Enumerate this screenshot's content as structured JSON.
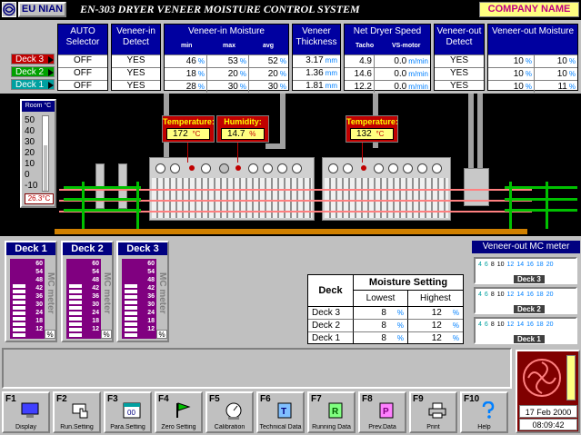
{
  "header": {
    "brand": "EU NIAN",
    "title": "EN-303 DRYER VENEER MOISTURE CONTROL SYSTEM",
    "company": "COMPANY NAME"
  },
  "columns": {
    "auto_selector": "AUTO Selector",
    "veneer_in_detect": "Veneer-in Detect",
    "veneer_in_moisture": "Veneer-in Moisture",
    "moisture_sub": [
      "min",
      "max",
      "avg"
    ],
    "veneer_thickness": "Veneer Thickness",
    "net_dryer_speed": "Net Dryer Speed",
    "speed_sub": [
      "Tacho",
      "VS-motor"
    ],
    "veneer_out_detect": "Veneer-out Detect",
    "veneer_out_moisture": "Veneer-out Moisture"
  },
  "units": {
    "pct": "%",
    "mm": "mm",
    "speed": "m/min",
    "temp": "°C"
  },
  "rows": [
    {
      "deck": "Deck 3",
      "color": "#c00000",
      "auto": "OFF",
      "in_detect": "YES",
      "min": "46",
      "max": "53",
      "avg": "52",
      "thick": "3.17",
      "tacho": "4.9",
      "vs": "0.0",
      "out_detect": "YES",
      "out_a": "10",
      "out_b": "10"
    },
    {
      "deck": "Deck 2",
      "color": "#00a000",
      "auto": "OFF",
      "in_detect": "YES",
      "min": "18",
      "max": "20",
      "avg": "20",
      "thick": "1.36",
      "tacho": "14.6",
      "vs": "0.0",
      "out_detect": "YES",
      "out_a": "10",
      "out_b": "10"
    },
    {
      "deck": "Deck 1",
      "color": "#00a0a0",
      "auto": "OFF",
      "in_detect": "YES",
      "min": "28",
      "max": "30",
      "avg": "30",
      "thick": "1.81",
      "tacho": "12.2",
      "vs": "0.0",
      "out_detect": "YES",
      "out_a": "10",
      "out_b": "11"
    }
  ],
  "room": {
    "label": "Room °C",
    "ticks": [
      "50",
      "40",
      "30",
      "20",
      "10",
      "0",
      "-10"
    ],
    "value": "26.3°C",
    "level": 26.3
  },
  "readouts": {
    "temp1_label": "Temperature:",
    "temp1_value": "172",
    "humidity_label": "Humidity:",
    "humidity_value": "14.7",
    "temp2_label": "Temperature:",
    "temp2_value": "132"
  },
  "meters": [
    {
      "title": "Deck 1",
      "side": "MC meter",
      "level": 12
    },
    {
      "title": "Deck 2",
      "side": "MC meter",
      "level": 12
    },
    {
      "title": "Deck 3",
      "side": "MC meter",
      "level": 12
    }
  ],
  "meter_ticks": [
    "60",
    "54",
    "48",
    "42",
    "36",
    "30",
    "24",
    "18",
    "12"
  ],
  "meter_pct": "%",
  "moisture_setting": {
    "deck_header": "Deck",
    "title": "Moisture Setting",
    "lowest": "Lowest",
    "highest": "Highest",
    "rows": [
      {
        "deck": "Deck 3",
        "low": "8",
        "high": "12"
      },
      {
        "deck": "Deck 2",
        "low": "8",
        "high": "12"
      },
      {
        "deck": "Deck 1",
        "low": "8",
        "high": "12"
      }
    ]
  },
  "veneer_out_mc": {
    "title": "Veneer-out MC meter",
    "scale": [
      "4",
      "6",
      "8",
      "10",
      "12",
      "14",
      "16",
      "18",
      "20"
    ],
    "decks": [
      "Deck 3",
      "Deck 2",
      "Deck 1"
    ]
  },
  "fkeys": [
    {
      "key": "F1",
      "label": "Display"
    },
    {
      "key": "F2",
      "label": "Run.Setting"
    },
    {
      "key": "F3",
      "label": "Para.Setting"
    },
    {
      "key": "F4",
      "label": "Zero Setting"
    },
    {
      "key": "F5",
      "label": "Calibration"
    },
    {
      "key": "F6",
      "label": "Technical Data"
    },
    {
      "key": "F7",
      "label": "Running Data"
    },
    {
      "key": "F8",
      "label": "Prev.Data"
    },
    {
      "key": "F9",
      "label": "Print"
    },
    {
      "key": "F10",
      "label": "Help"
    }
  ],
  "fkey_icon_letters": {
    "f3": "00",
    "f6": "T",
    "f7": "R",
    "f8": "P"
  },
  "clock": {
    "date": "17 Feb 2000",
    "time": "08:09:42"
  }
}
